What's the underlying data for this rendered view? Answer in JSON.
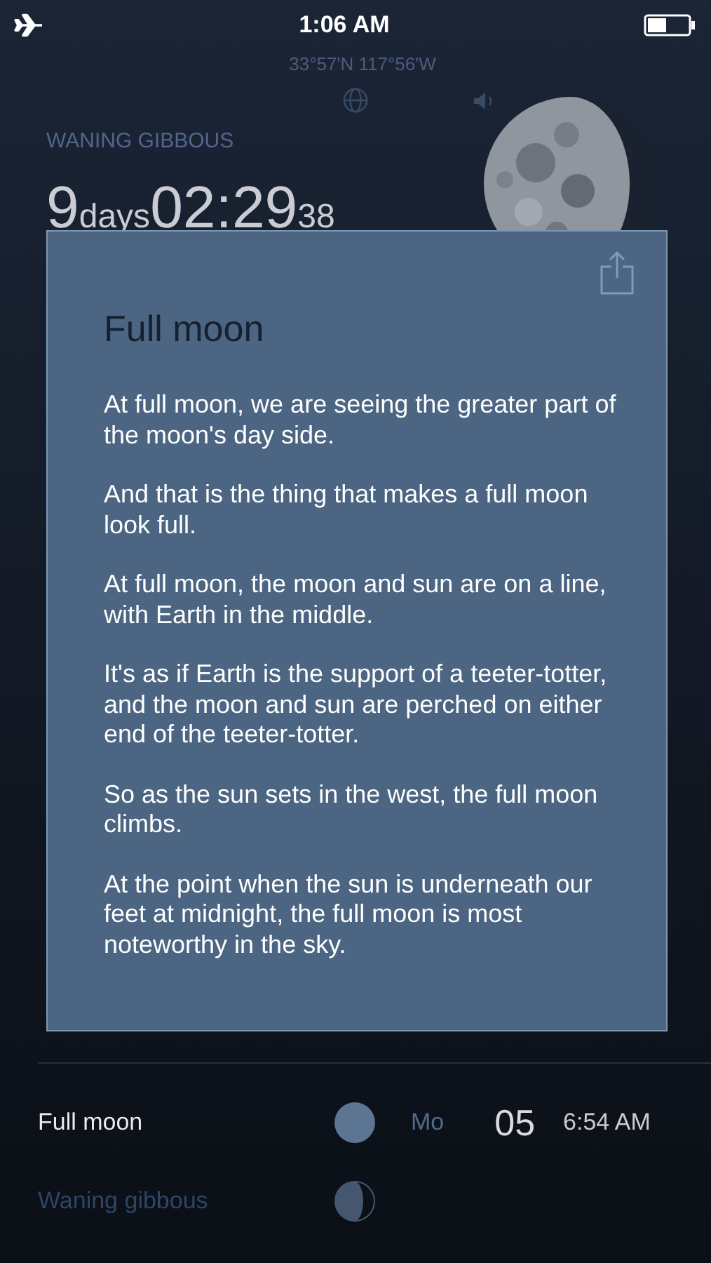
{
  "status_bar": {
    "time": "1:06 AM"
  },
  "location": "33°57'N 117°56'W",
  "phase_name": "WANING GIBBOUS",
  "countdown": {
    "days": "9",
    "days_unit": "days",
    "hours_minutes": "02:29",
    "seconds": "38"
  },
  "dialog": {
    "title": "Full moon",
    "paragraphs": [
      "At full moon, we are seeing the greater part of the moon's day side.",
      "And that is the thing that makes a full moon look full.",
      "At full moon, the moon and sun are on a line, with Earth in the middle.",
      "It's as if Earth is the support of a teeter-totter, and the moon and sun are perched on either end of the teeter-totter.",
      "So as the sun sets in the west, the full moon climbs.",
      "At the point when the sun is underneath our feet at midnight, the full moon is most noteworthy in the sky."
    ]
  },
  "phases": [
    {
      "label": "Full moon",
      "kind": "full",
      "selected": true,
      "weekday": "Mo",
      "day": "05",
      "time": "6:54 AM"
    },
    {
      "label": "Waning gibbous",
      "kind": "waning_gibbous",
      "selected": false
    }
  ]
}
